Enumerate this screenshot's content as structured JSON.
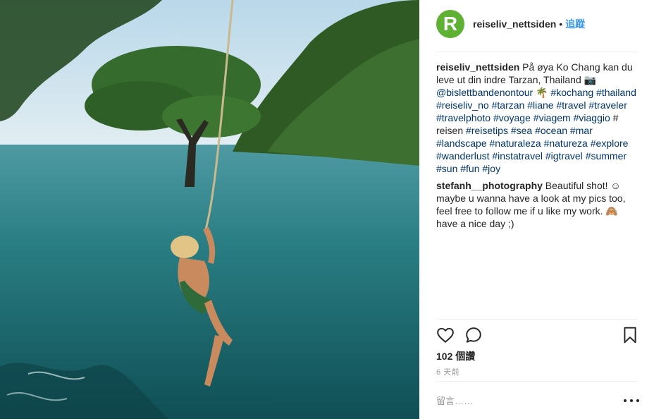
{
  "post": {
    "username": "reiseliv_nettsiden",
    "avatar_letter": "R",
    "separator": "•",
    "follow_label": "追蹤",
    "photo_alt": "Boy swinging on a rope over turquoise water"
  },
  "caption": {
    "username": "reiseliv_nettsiden",
    "text": " På øya Ko Chang kan du leve ut din indre Tarzan, Thailand 📷 ",
    "mention": "@bislettbandenontour",
    "palm_emoji": " 🌴 ",
    "tags_a": [
      "#kochang",
      "#thailand",
      "#reiseliv_no",
      "#tarzan",
      "#liane",
      "#travel",
      "#traveler",
      "#travelphoto",
      "#voyage",
      "#viagem",
      "#viaggio"
    ],
    "plain": "# reisen",
    "tags_b": [
      "#reisetips",
      "#sea",
      "#ocean",
      "#mar",
      "#landscape",
      "#naturaleza",
      "#natureza",
      "#explore",
      "#wanderlust",
      "#instatravel",
      "#igtravel",
      "#summer",
      "#sun",
      "#fun",
      "#joy"
    ]
  },
  "comment": {
    "username": "stefanh__photography",
    "text": " Beautiful shot! ☺ maybe u wanna have a look at my pics too, feel free to follow me if u like my work. 🙈 have a nice day ;)"
  },
  "actions": {
    "like_icon": "heart-icon",
    "comment_icon": "comment-bubble-icon",
    "save_icon": "bookmark-icon"
  },
  "stats": {
    "likes": "102 個讚",
    "time_ago": "6 天前"
  },
  "add_comment": {
    "placeholder": "留言……",
    "more_icon": "ellipsis-icon"
  },
  "colors": {
    "avatar_bg": "#5fb133",
    "follow": "#3897f0",
    "hashtag": "#003569"
  }
}
